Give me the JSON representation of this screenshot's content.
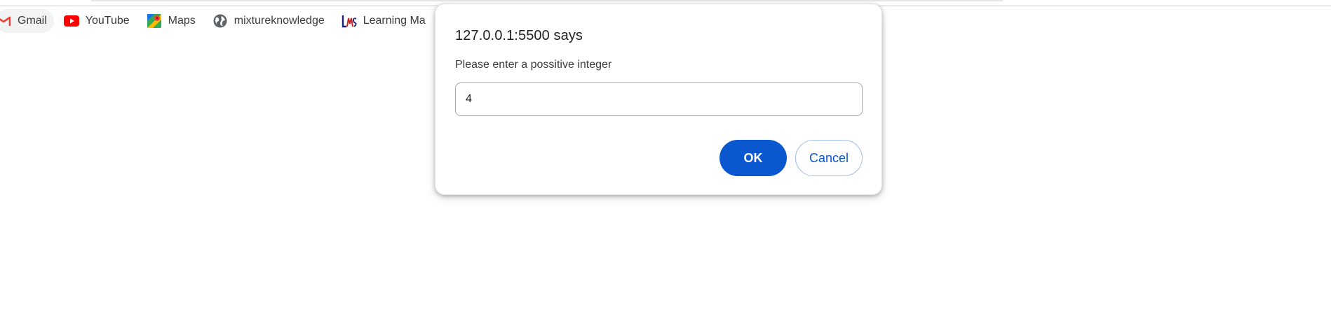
{
  "bookmarks": [
    {
      "label": "Gmail",
      "icon": "gmail-icon"
    },
    {
      "label": "YouTube",
      "icon": "youtube-icon"
    },
    {
      "label": "Maps",
      "icon": "maps-icon"
    },
    {
      "label": "mixtureknowledge",
      "icon": "globe-icon"
    },
    {
      "label": "Learning Ma",
      "icon": "lms-icon"
    }
  ],
  "dialog": {
    "title": "127.0.0.1:5500 says",
    "message": "Please enter a possitive integer",
    "input_value": "4",
    "ok_label": "OK",
    "cancel_label": "Cancel"
  },
  "colors": {
    "primary": "#0b57d0",
    "youtube_red": "#ff0000",
    "gmail_red": "#ea4335"
  }
}
